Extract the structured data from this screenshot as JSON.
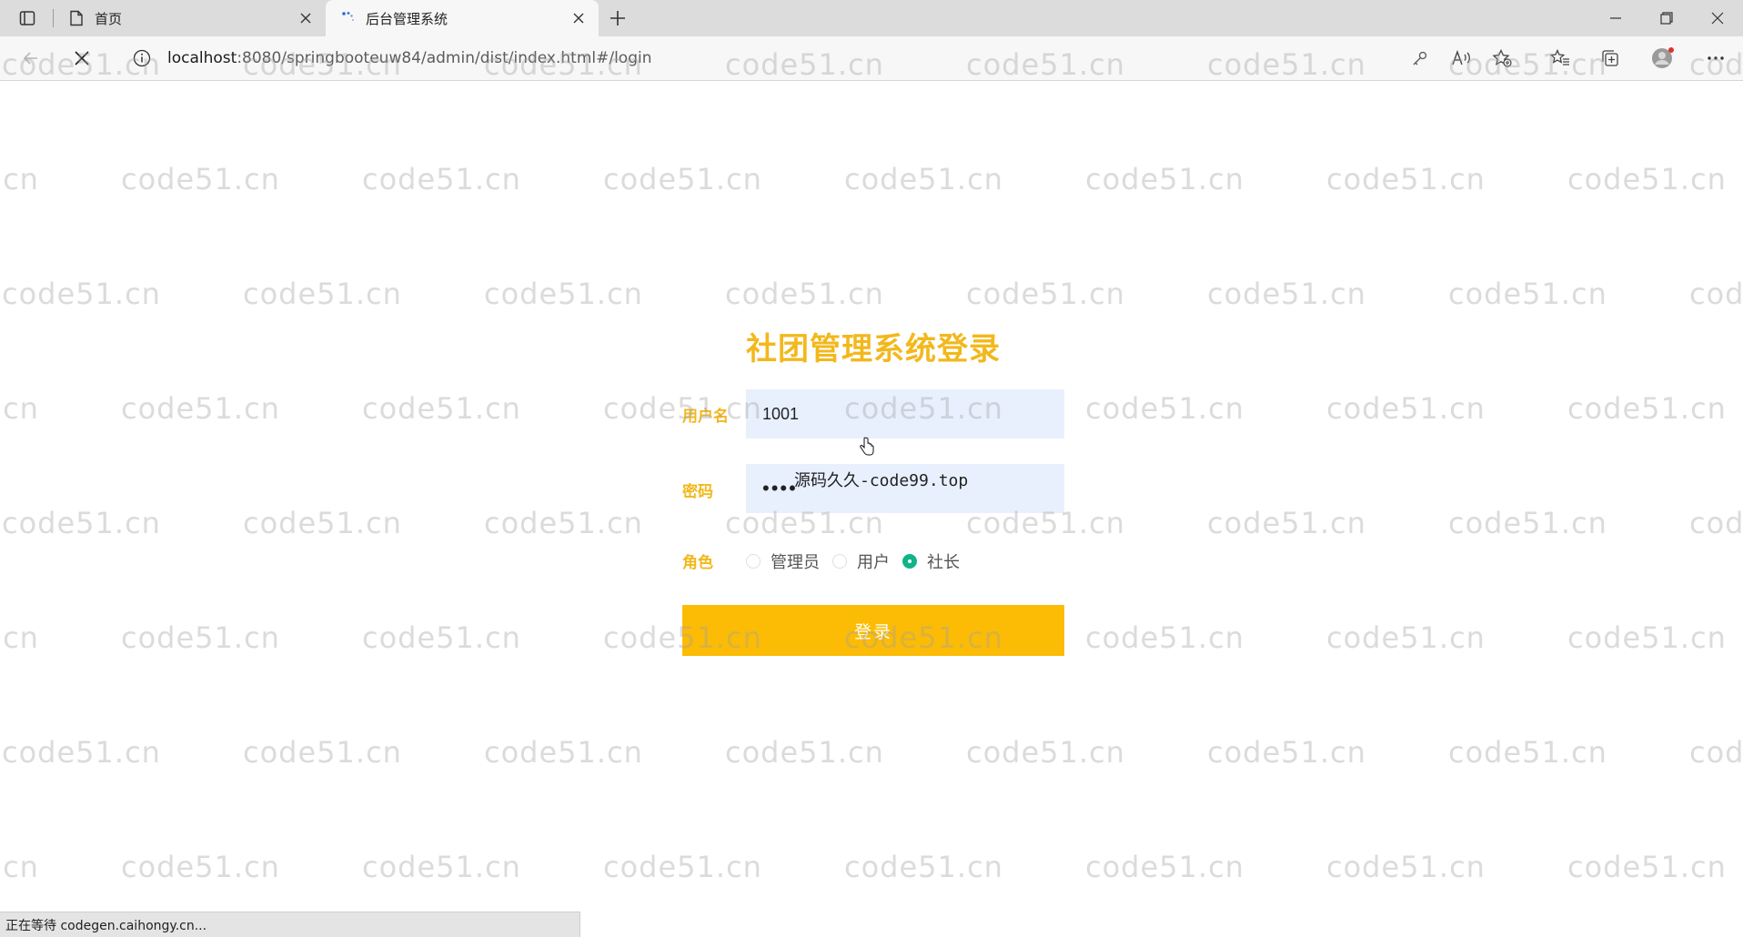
{
  "browser": {
    "tabs": [
      {
        "title": "首页",
        "icon": "page-icon",
        "active": false
      },
      {
        "title": "后台管理系统",
        "icon": "loading-spinner-icon",
        "active": true
      }
    ],
    "url_host": "localhost",
    "url_path": ":8080/springbooteuw84/admin/dist/index.html#/login",
    "status_text": "正在等待 codegen.caihongy.cn..."
  },
  "watermark": {
    "text": "code51.cn"
  },
  "login": {
    "title": "社团管理系统登录",
    "username_label": "用户名",
    "username_value": "1001",
    "password_label": "密码",
    "password_value": "••••",
    "password_overlay": "源码久久-code99.top",
    "role_label": "角色",
    "roles": [
      {
        "label": "管理员",
        "checked": false
      },
      {
        "label": "用户",
        "checked": false
      },
      {
        "label": "社长",
        "checked": true
      }
    ],
    "submit_label": "登录"
  },
  "colors": {
    "accent": "#f2b81c",
    "button": "#fcbc05",
    "input_bg": "#e8f0fe",
    "radio_checked": "#13b38a"
  }
}
